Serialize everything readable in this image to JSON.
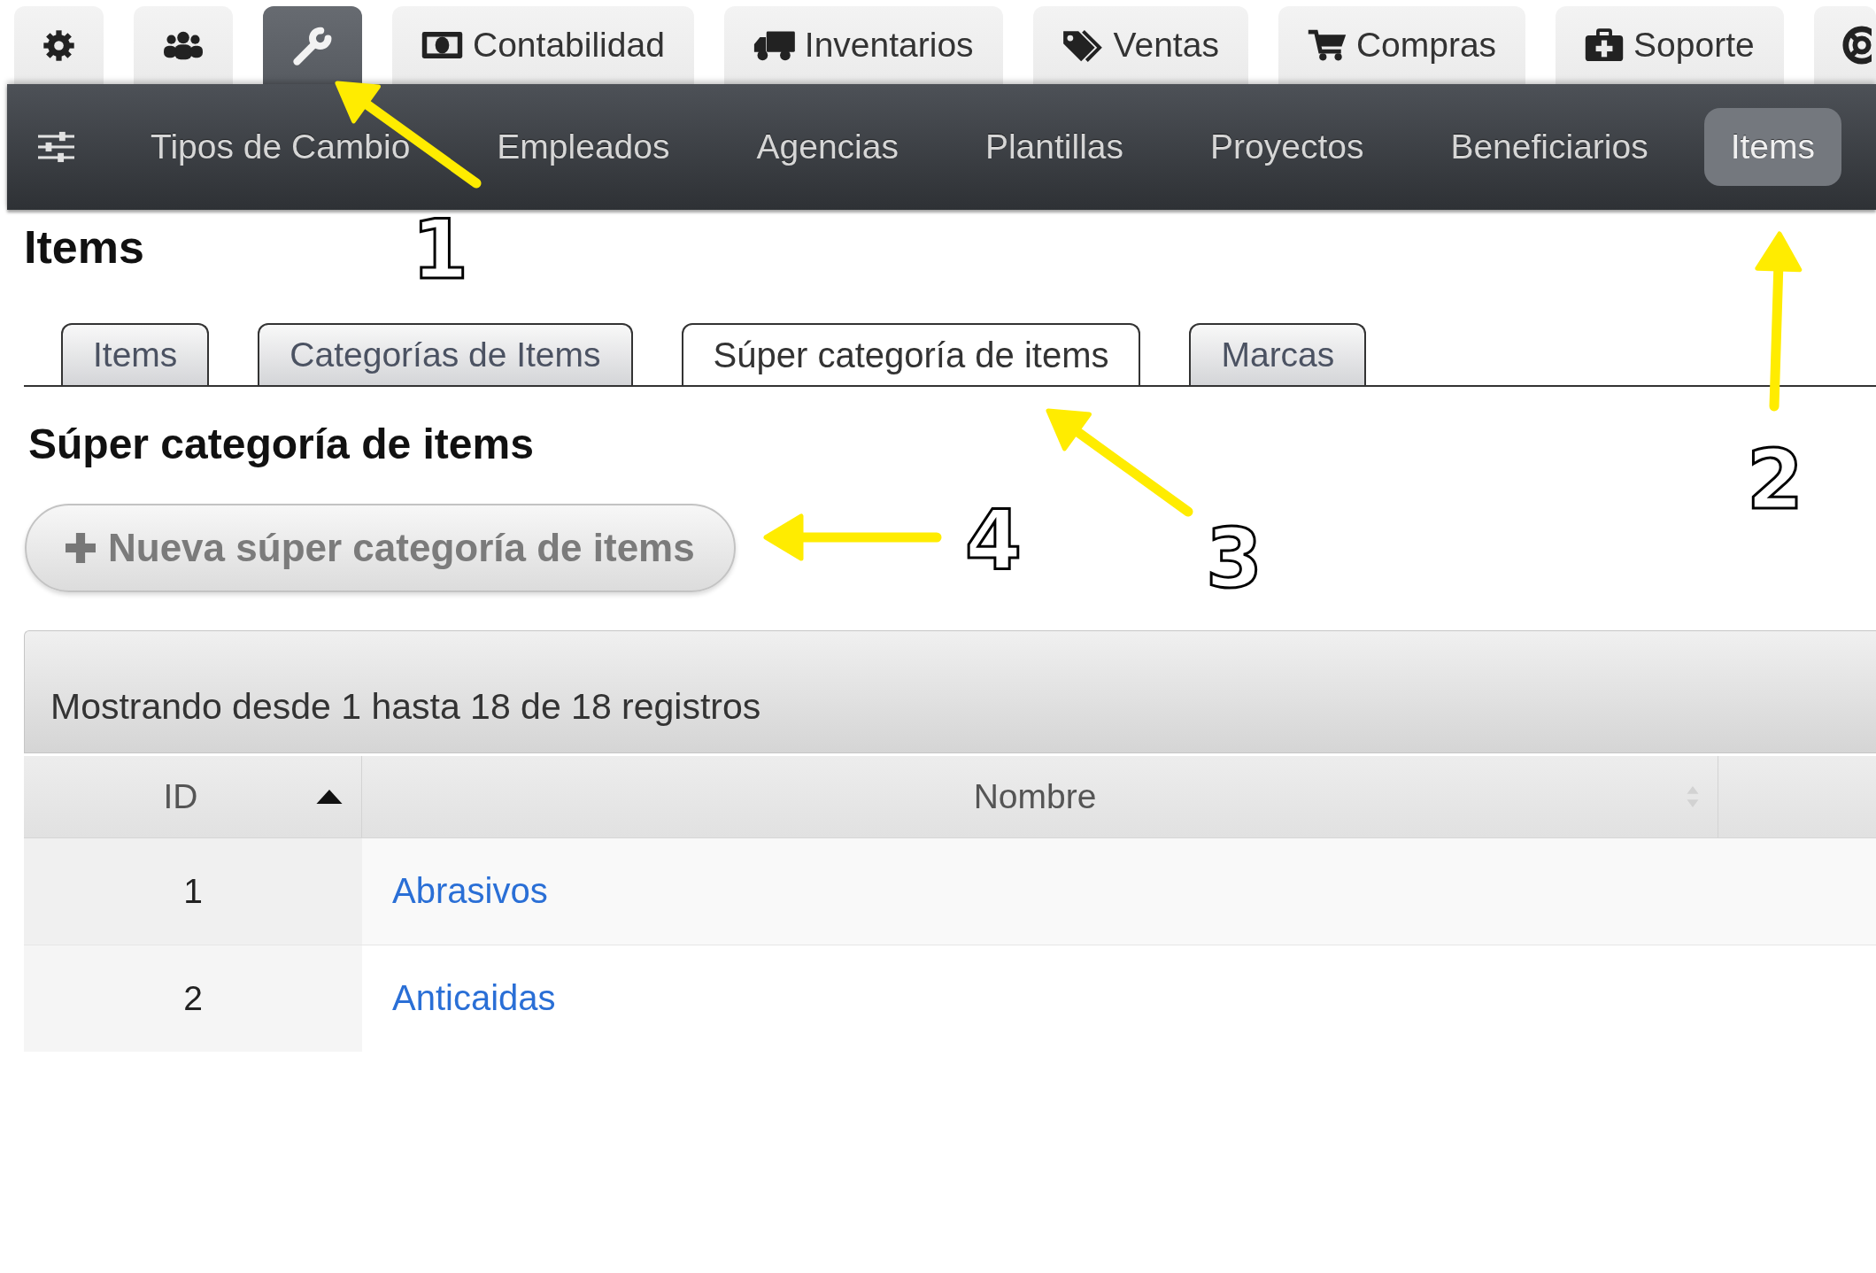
{
  "module_tabs": [
    {
      "selected": false
    },
    {
      "selected": false
    },
    {
      "selected": true
    },
    {
      "label": "Contabilidad",
      "selected": false
    },
    {
      "label": "Inventarios",
      "selected": false
    },
    {
      "label": "Ventas",
      "selected": false
    },
    {
      "label": "Compras",
      "selected": false
    },
    {
      "label": "Soporte",
      "selected": false
    },
    {
      "selected": false
    }
  ],
  "nav_items": [
    {
      "label": "Tipos de Cambio",
      "selected": false
    },
    {
      "label": "Empleados",
      "selected": false
    },
    {
      "label": "Agencias",
      "selected": false
    },
    {
      "label": "Plantillas",
      "selected": false
    },
    {
      "label": "Proyectos",
      "selected": false
    },
    {
      "label": "Beneficiarios",
      "selected": false
    },
    {
      "label": "Items",
      "selected": true
    }
  ],
  "page_title": "Items",
  "sub_tabs": [
    {
      "label": "Items",
      "selected": false
    },
    {
      "label": "Categorías de Items",
      "selected": false
    },
    {
      "label": "Súper categoría de items",
      "selected": true
    },
    {
      "label": "Marcas",
      "selected": false
    }
  ],
  "section_title": "Súper categoría de items",
  "new_button": {
    "label": "Nueva súper categoría de items"
  },
  "table": {
    "info": "Mostrando desde 1 hasta 18 de 18 registros",
    "columns": [
      {
        "label": "ID",
        "sorted": true
      },
      {
        "label": "Nombre",
        "sorted": false
      }
    ],
    "rows": [
      {
        "id": "1",
        "name": "Abrasivos"
      },
      {
        "id": "2",
        "name": "Anticaidas"
      }
    ]
  },
  "annotations": [
    {
      "number": "1"
    },
    {
      "number": "2"
    },
    {
      "number": "3"
    },
    {
      "number": "4"
    }
  ]
}
